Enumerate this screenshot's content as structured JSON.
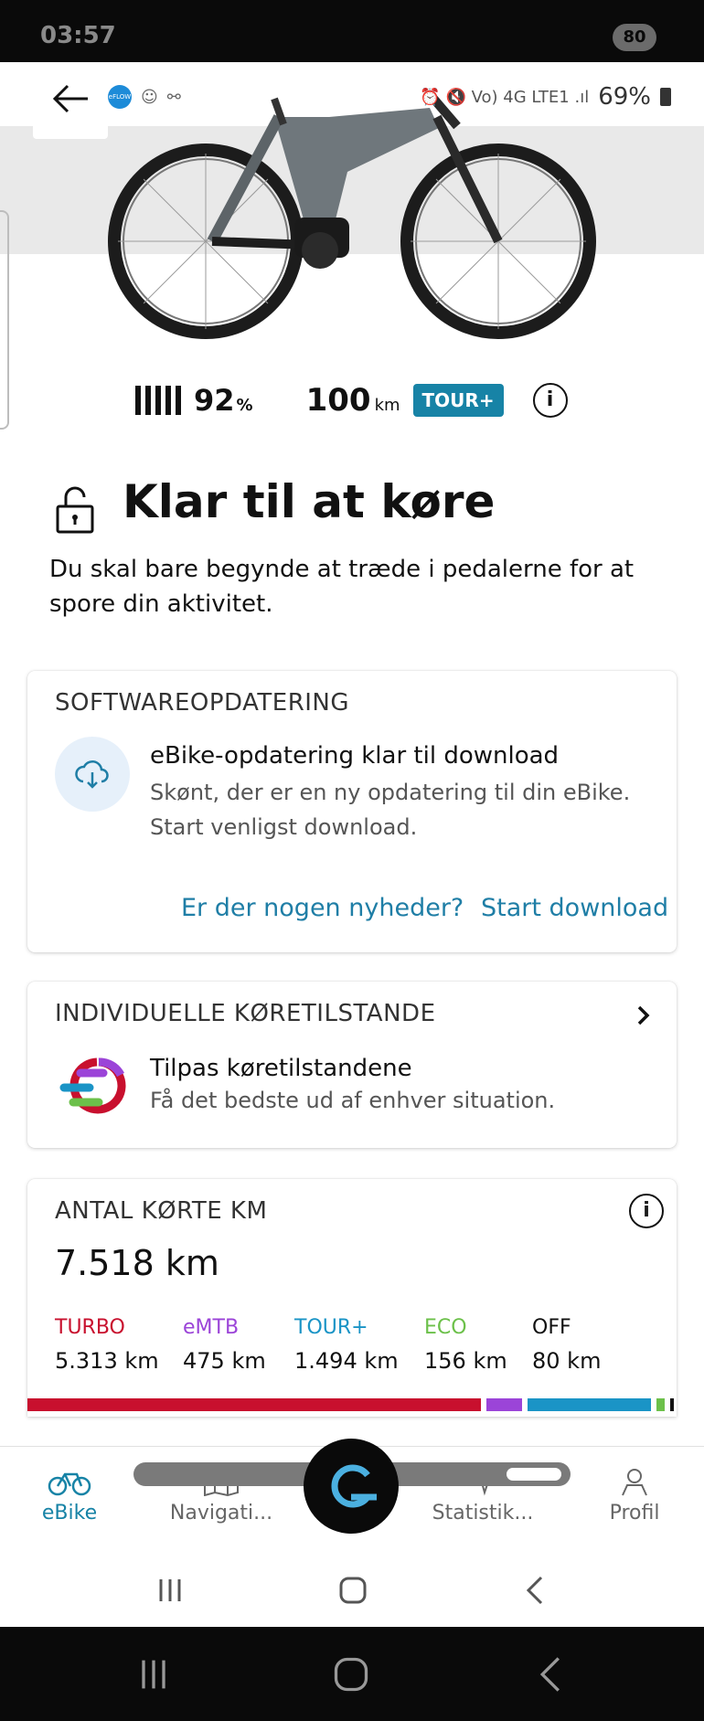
{
  "outer_status": {
    "time": "03:57",
    "icons": "🔕 ⌘ ▮",
    "pill": "80"
  },
  "inner_status": {
    "left_icons": [
      "e-bike-flow-logo",
      "person-icon",
      "bike-icon"
    ],
    "right_icons": "⏰ 🔇 Vo) 4G LTE1 .ıl",
    "battery": "69%"
  },
  "bike_stats": {
    "battery_percent": "92",
    "battery_unit": "%",
    "range": "100",
    "range_unit": "km",
    "mode": "TOUR+",
    "info": "i"
  },
  "ready": {
    "title": "Klar til at køre",
    "subtitle": "Du skal bare begynde at træde i pedalerne for at spore din aktivitet."
  },
  "software_update": {
    "heading": "SOFTWAREOPDATERING",
    "title": "eBike-opdatering klar til download",
    "body": "Skønt, der er en ny opdatering til din eBike. Start venligst download.",
    "link_news": "Er der nogen nyheder?",
    "link_download": "Start download"
  },
  "riding_modes": {
    "heading": "INDIVIDUELLE KØRETILSTANDE",
    "title": "Tilpas køretilstandene",
    "body": "Få det bedste ud af enhver situation."
  },
  "distance": {
    "heading": "ANTAL KØRTE KM",
    "total": "7.518 km",
    "info": "i",
    "modes": [
      {
        "name": "TURBO",
        "value": "5.313 km",
        "color": "#c8102e",
        "km": 5313
      },
      {
        "name": "eMTB",
        "value": "475 km",
        "color": "#9b44d8",
        "km": 475
      },
      {
        "name": "TOUR+",
        "value": "1.494 km",
        "color": "#1a94c6",
        "km": 1494
      },
      {
        "name": "ECO",
        "value": "156 km",
        "color": "#6cc04a",
        "km": 156
      },
      {
        "name": "OFF",
        "value": "80 km",
        "color": "#111111",
        "km": 80
      }
    ]
  },
  "bottom_nav": {
    "items": [
      {
        "label": "eBike",
        "icon": "bike-icon",
        "active": true
      },
      {
        "label": "Navigati...",
        "icon": "map-icon",
        "active": false
      },
      {
        "label": "Statistik...",
        "icon": "activity-icon",
        "active": false
      },
      {
        "label": "Profil",
        "icon": "profile-icon",
        "active": false
      }
    ]
  },
  "colors": {
    "accent": "#1783a6",
    "link": "#1f7ea6",
    "cloud_bg": "#e6f0fa"
  }
}
